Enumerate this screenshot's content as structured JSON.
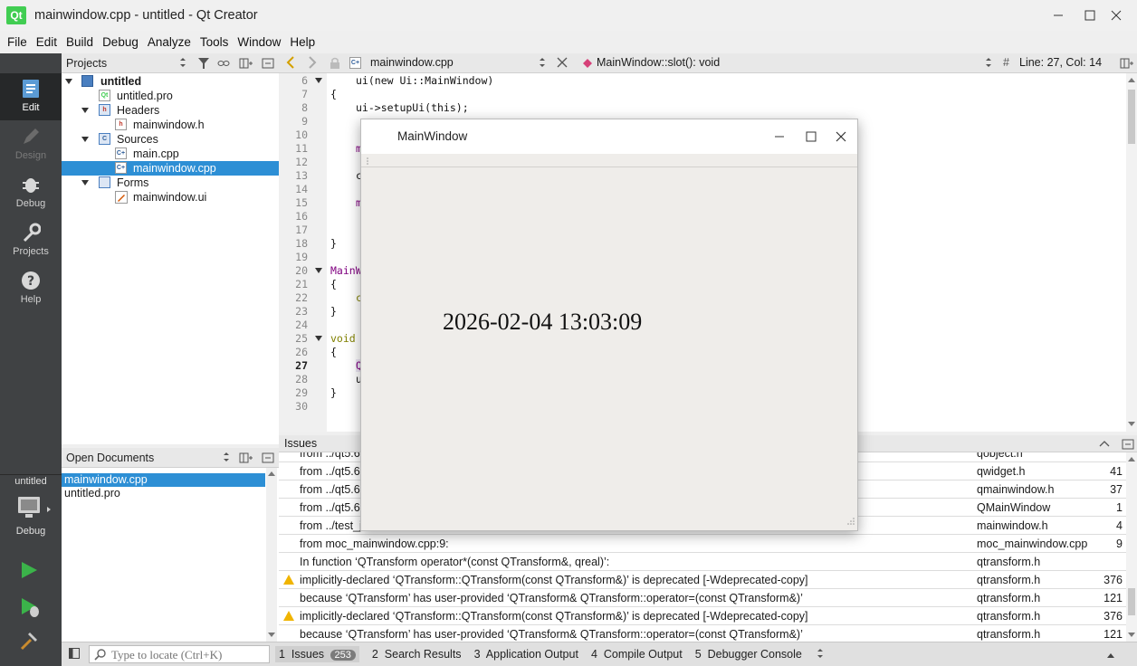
{
  "window": {
    "title": "mainwindow.cpp - untitled - Qt Creator",
    "logo": "Qt"
  },
  "menu": [
    "File",
    "Edit",
    "Build",
    "Debug",
    "Analyze",
    "Tools",
    "Window",
    "Help"
  ],
  "modes": [
    {
      "label": "Edit",
      "icon": "edit-icon"
    },
    {
      "label": "Design",
      "icon": "design-icon"
    },
    {
      "label": "Debug",
      "icon": "debug-icon"
    },
    {
      "label": "Projects",
      "icon": "projects-icon"
    },
    {
      "label": "Help",
      "icon": "help-icon"
    }
  ],
  "kit": {
    "project": "untitled",
    "config": "Debug"
  },
  "projects_pane": {
    "title": "Projects",
    "tree": [
      {
        "label": "untitled",
        "level": 0,
        "expanded": true,
        "bold": true
      },
      {
        "label": "untitled.pro",
        "level": 1
      },
      {
        "label": "Headers",
        "level": 1,
        "expanded": true
      },
      {
        "label": "mainwindow.h",
        "level": 2
      },
      {
        "label": "Sources",
        "level": 1,
        "expanded": true
      },
      {
        "label": "main.cpp",
        "level": 2
      },
      {
        "label": "mainwindow.cpp",
        "level": 2,
        "selected": true
      },
      {
        "label": "Forms",
        "level": 1,
        "expanded": true
      },
      {
        "label": "mainwindow.ui",
        "level": 2
      }
    ]
  },
  "open_documents": {
    "title": "Open Documents",
    "items": [
      "mainwindow.cpp",
      "untitled.pro"
    ]
  },
  "editor_toolbar": {
    "file": "mainwindow.cpp",
    "symbol": "MainWindow::slot(): void",
    "position": "Line: 27, Col: 14",
    "hash": "#"
  },
  "editor": {
    "line_numbers": [
      "6",
      "7",
      "8",
      "9",
      "10",
      "11",
      "12",
      "13",
      "14",
      "15",
      "16",
      "17",
      "18",
      "19",
      "20",
      "21",
      "22",
      "23",
      "24",
      "25",
      "26",
      "27",
      "28",
      "29",
      "30"
    ],
    "current_line": "27",
    "lines": {
      "l6": "ui(new Ui::MainWindow)",
      "l7": "{",
      "l8": "ui->setupUi(this);",
      "l11": "m",
      "l13": "c",
      "l15": "m",
      "l18": "}",
      "l20": "MainW",
      "l21": "{",
      "l22": "c",
      "l23": "}",
      "l25": "void",
      "l26": "{",
      "l27": "Q",
      "l28": "u",
      "l29": "}"
    }
  },
  "issues": {
    "title": "Issues",
    "rows": [
      {
        "desc": "from ../qt5.6",
        "file": "qobject.h",
        "line": "",
        "warn": false
      },
      {
        "desc": "from ../qt5.6",
        "file": "qwidget.h",
        "line": "41",
        "warn": false
      },
      {
        "desc": "from ../qt5.6",
        "file": "qmainwindow.h",
        "line": "37",
        "warn": false
      },
      {
        "desc": "from ../qt5.6",
        "file": "QMainWindow",
        "line": "1",
        "warn": false
      },
      {
        "desc": "from ../test_j",
        "file": "mainwindow.h",
        "line": "4",
        "warn": false
      },
      {
        "desc": "from moc_mainwindow.cpp:9:",
        "file": "moc_mainwindow.cpp",
        "line": "9",
        "warn": false
      },
      {
        "desc": "In function ‘QTransform operator*(const QTransform&, qreal)’:",
        "file": "qtransform.h",
        "line": "",
        "warn": false
      },
      {
        "desc": "implicitly-declared ‘QTransform::QTransform(const QTransform&)’ is deprecated [-Wdeprecated-copy]",
        "file": "qtransform.h",
        "line": "376",
        "warn": true
      },
      {
        "desc": "because ‘QTransform’ has user-provided ‘QTransform& QTransform::operator=(const QTransform&)’",
        "file": "qtransform.h",
        "line": "121",
        "warn": false
      },
      {
        "desc": "implicitly-declared ‘QTransform::QTransform(const QTransform&)’ is deprecated [-Wdeprecated-copy]",
        "file": "qtransform.h",
        "line": "376",
        "warn": true
      },
      {
        "desc": "because ‘QTransform’ has user-provided ‘QTransform& QTransform::operator=(const QTransform&)’",
        "file": "qtransform.h",
        "line": "121",
        "warn": false
      }
    ]
  },
  "statusbar": {
    "locate_placeholder": "Type to locate (Ctrl+K)",
    "tabs": [
      {
        "num": "1",
        "label": "Issues",
        "badge": "253"
      },
      {
        "num": "2",
        "label": "Search Results"
      },
      {
        "num": "3",
        "label": "Application Output"
      },
      {
        "num": "4",
        "label": "Compile Output"
      },
      {
        "num": "5",
        "label": "Debugger Console"
      }
    ]
  },
  "app_window": {
    "title": "MainWindow",
    "datetime": "2026-02-04 13:03:09"
  },
  "colors": {
    "accent": "#2d8fd5",
    "modebar": "#404244",
    "qt_green": "#41cd52",
    "warning": "#f0b400"
  }
}
